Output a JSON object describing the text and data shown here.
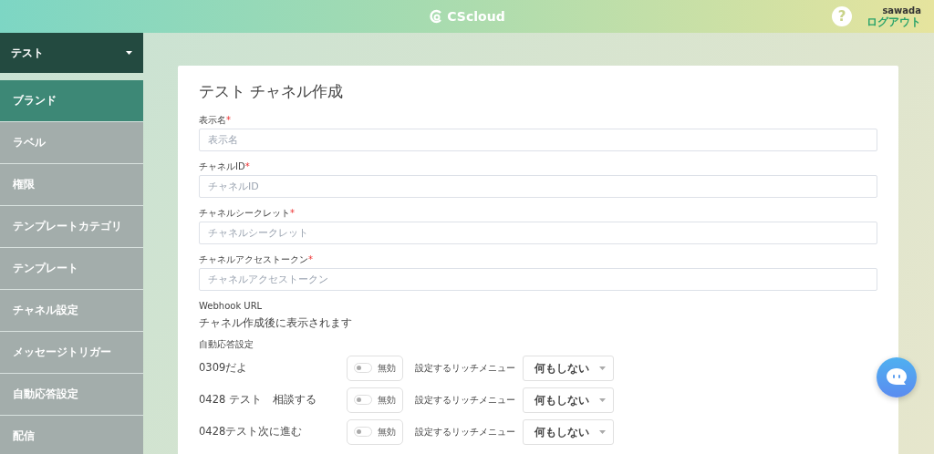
{
  "header": {
    "logo_text": "CScloud",
    "help": "?",
    "user": "sawada",
    "logout": "ログアウト"
  },
  "sidebar": {
    "selector": "テスト",
    "items": [
      {
        "label": "ブランド",
        "selected": true
      },
      {
        "label": "ラベル",
        "selected": false
      },
      {
        "label": "権限",
        "selected": false
      },
      {
        "label": "テンプレートカテゴリ",
        "selected": false
      },
      {
        "label": "テンプレート",
        "selected": false
      },
      {
        "label": "チャネル設定",
        "selected": false
      },
      {
        "label": "メッセージトリガー",
        "selected": false
      },
      {
        "label": "自動応答設定",
        "selected": false
      },
      {
        "label": "配信",
        "selected": false
      }
    ]
  },
  "form": {
    "title": "テスト チャネル作成",
    "fields": [
      {
        "label": "表示名",
        "required": "*",
        "placeholder": "表示名"
      },
      {
        "label": "チャネルID",
        "required": "*",
        "placeholder": "チャネルID"
      },
      {
        "label": "チャネルシークレット",
        "required": "*",
        "placeholder": "チャネルシークレット"
      },
      {
        "label": "チャネルアクセストークン",
        "required": "*",
        "placeholder": "チャネルアクセストークン"
      }
    ],
    "webhook": {
      "label": "Webhook URL",
      "value": "チャネル作成後に表示されます"
    },
    "auto_reply": {
      "label": "自動応答設定",
      "rows": [
        {
          "name": "0309だよ",
          "on": false,
          "state_text": "無効",
          "menu_label": "設定するリッチメニュー",
          "menu_value": "何もしない"
        },
        {
          "name": "0428 テスト　相談する",
          "on": false,
          "state_text": "無効",
          "menu_label": "設定するリッチメニュー",
          "menu_value": "何もしない"
        },
        {
          "name": "0428テスト次に進む",
          "on": false,
          "state_text": "無効",
          "menu_label": "設定するリッチメニュー",
          "menu_value": "何もしない"
        }
      ]
    }
  }
}
